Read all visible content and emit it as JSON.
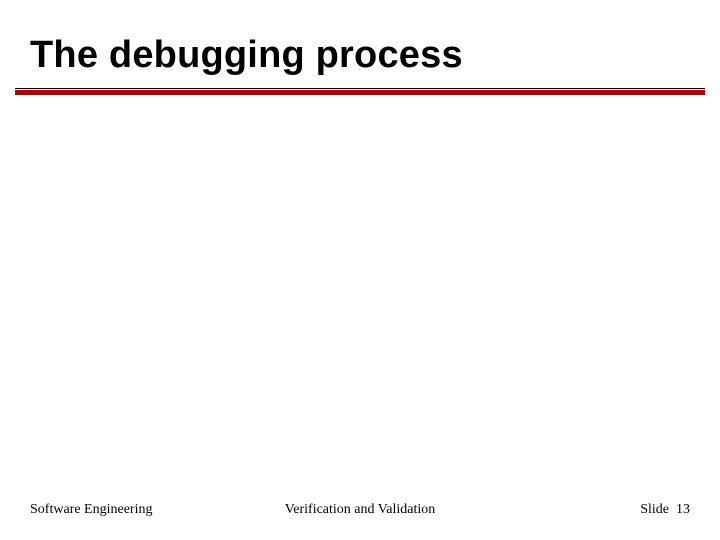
{
  "title": "The debugging process",
  "footer": {
    "left": "Software Engineering",
    "center": "Verification and Validation",
    "right_label": "Slide",
    "right_number": "13"
  }
}
